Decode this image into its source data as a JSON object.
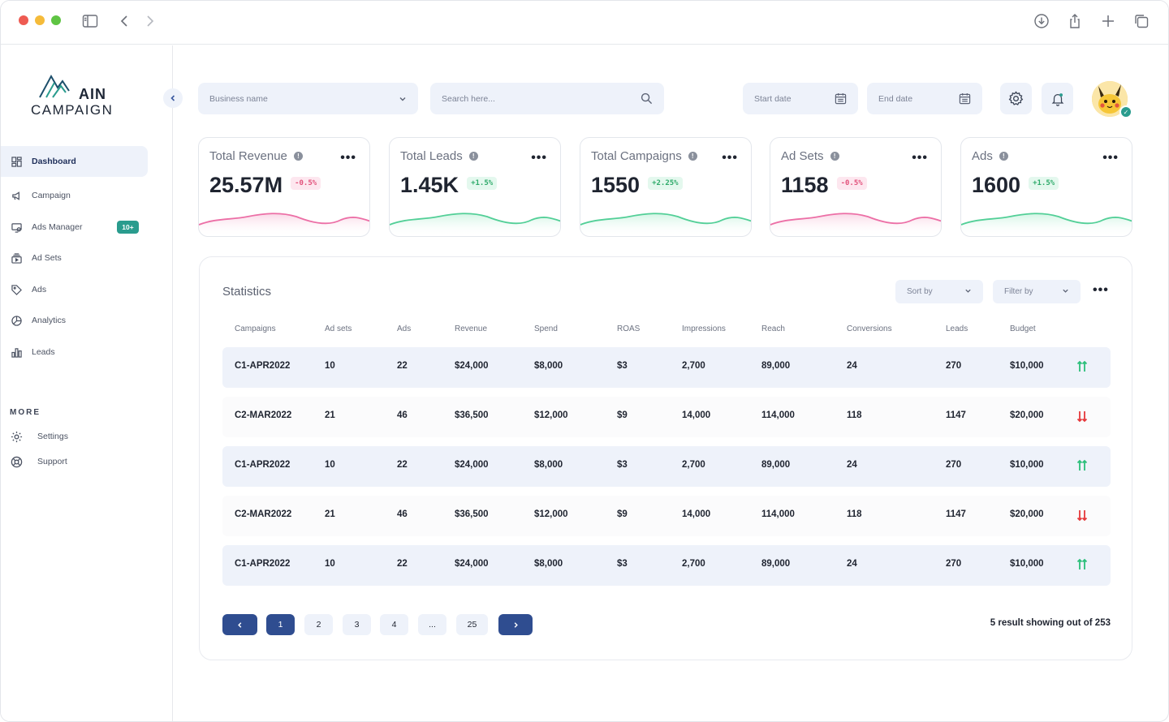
{
  "logo": {
    "line1": "AIN",
    "line2": "CAMPAIGN"
  },
  "sidebar": {
    "items": [
      {
        "label": "Dashboard",
        "icon": "dashboard-icon"
      },
      {
        "label": "Campaign",
        "icon": "megaphone-icon"
      },
      {
        "label": "Ads Manager",
        "icon": "ads-manager-icon",
        "badge": "10+"
      },
      {
        "label": "Ad Sets",
        "icon": "ad-sets-icon"
      },
      {
        "label": "Ads",
        "icon": "tag-icon"
      },
      {
        "label": "Analytics",
        "icon": "analytics-icon"
      },
      {
        "label": "Leads",
        "icon": "bar-chart-icon"
      }
    ],
    "more_label": "MORE",
    "more_items": [
      {
        "label": "Settings",
        "icon": "settings-icon"
      },
      {
        "label": "Support",
        "icon": "support-icon"
      }
    ]
  },
  "toolbar": {
    "business_placeholder": "Business name",
    "search_placeholder": "Search here...",
    "start_date_placeholder": "Start date",
    "end_date_placeholder": "End date"
  },
  "cards": [
    {
      "title": "Total Revenue",
      "value": "25.57M",
      "delta": "-0.5%",
      "trend": "negative"
    },
    {
      "title": "Total Leads",
      "value": "1.45K",
      "delta": "+1.5%",
      "trend": "positive"
    },
    {
      "title": "Total Campaigns",
      "value": "1550",
      "delta": "+2.25%",
      "trend": "positive"
    },
    {
      "title": "Ad Sets",
      "value": "1158",
      "delta": "-0.5%",
      "trend": "negative"
    },
    {
      "title": "Ads",
      "value": "1600",
      "delta": "+1.5%",
      "trend": "positive"
    }
  ],
  "statistics": {
    "title": "Statistics",
    "sort_label": "Sort by",
    "filter_label": "Filter by",
    "columns": [
      "Campaigns",
      "Ad sets",
      "Ads",
      "Revenue",
      "Spend",
      "ROAS",
      "Impressions",
      "Reach",
      "Conversions",
      "Leads",
      "Budget"
    ],
    "rows": [
      {
        "cells": [
          "C1-APR2022",
          "10",
          "22",
          "$24,000",
          "$8,000",
          "$3",
          "2,700",
          "89,000",
          "24",
          "270",
          "$10,000"
        ],
        "trend": "up"
      },
      {
        "cells": [
          "C2-MAR2022",
          "21",
          "46",
          "$36,500",
          "$12,000",
          "$9",
          "14,000",
          "114,000",
          "118",
          "1147",
          "$20,000"
        ],
        "trend": "down"
      },
      {
        "cells": [
          "C1-APR2022",
          "10",
          "22",
          "$24,000",
          "$8,000",
          "$3",
          "2,700",
          "89,000",
          "24",
          "270",
          "$10,000"
        ],
        "trend": "up"
      },
      {
        "cells": [
          "C2-MAR2022",
          "21",
          "46",
          "$36,500",
          "$12,000",
          "$9",
          "14,000",
          "114,000",
          "118",
          "1147",
          "$20,000"
        ],
        "trend": "down"
      },
      {
        "cells": [
          "C1-APR2022",
          "10",
          "22",
          "$24,000",
          "$8,000",
          "$3",
          "2,700",
          "89,000",
          "24",
          "270",
          "$10,000"
        ],
        "trend": "up"
      }
    ],
    "pagination": {
      "pages": [
        "1",
        "2",
        "3",
        "4",
        "...",
        "25"
      ],
      "active_page": "1",
      "result_text": "5 result showing out of 253"
    }
  },
  "colors": {
    "accent": "#2f4d90",
    "positive": "#2eaa6a",
    "negative": "#e2517b",
    "trend_up": "#2bbf7a",
    "trend_down": "#e5383b"
  }
}
